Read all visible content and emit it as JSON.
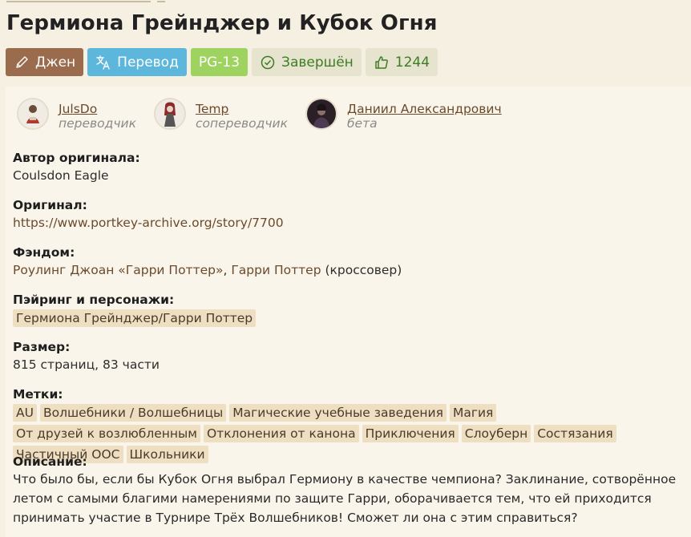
{
  "title": "Гермиона Грейнджер и Кубок Огня",
  "badges": {
    "direction": "Джен",
    "type": "Перевод",
    "rating": "PG-13",
    "status": "Завершён",
    "likes": "1244"
  },
  "authors": [
    {
      "name": "JulsDo",
      "role": "переводчик"
    },
    {
      "name": "Temp",
      "role": "сопереводчик"
    },
    {
      "name": "Даниил Александрович",
      "role": "бета"
    }
  ],
  "original_author": {
    "label": "Автор оригинала:",
    "value": "Coulsdon Eagle"
  },
  "original": {
    "label": "Оригинал:",
    "value": "https://www.portkey-archive.org/story/7700"
  },
  "fandom": {
    "label": "Фэндом:",
    "link1": "Роулинг Джоан «Гарри Поттер»",
    "sep": ", ",
    "link2": "Гарри Поттер",
    "suffix": " (кроссовер)"
  },
  "pairing": {
    "label": "Пэйринг и персонажи:",
    "items": [
      "Гермиона Грейнджер/Гарри Поттер"
    ]
  },
  "size": {
    "label": "Размер:",
    "value": "815 страниц, 83 части"
  },
  "tags": {
    "label": "Метки:",
    "items": [
      "AU",
      "Волшебники / Волшебницы",
      "Магические учебные заведения",
      "Магия",
      "От друзей к возлюбленным",
      "Отклонения от канона",
      "Приключения",
      "Слоуберн",
      "Состязания",
      "Частичный ООС",
      "Школьники"
    ]
  },
  "description": {
    "label": "Описание:",
    "text": "Что было бы, если бы Кубок Огня выбрал Гермиону в качестве чемпиона? Заклинание, сотворённое летом с самыми благими намерениями по защите Гарри, оборачивается тем, что ей приходится принимать участие в Турнире Трёх Волшебников! Сможет ли она с этим справиться?"
  },
  "colors": {
    "direction": "#9a6b4d",
    "type": "#5db7dc",
    "rating": "#9ed35f",
    "status_text": "#3d7d22",
    "tag_bg": "#eedfc3",
    "link": "#6b4a2c"
  },
  "icons": {
    "direction": "pencil-icon",
    "type": "translate-icon",
    "status": "check-circle-icon",
    "likes": "thumbs-up-icon"
  }
}
